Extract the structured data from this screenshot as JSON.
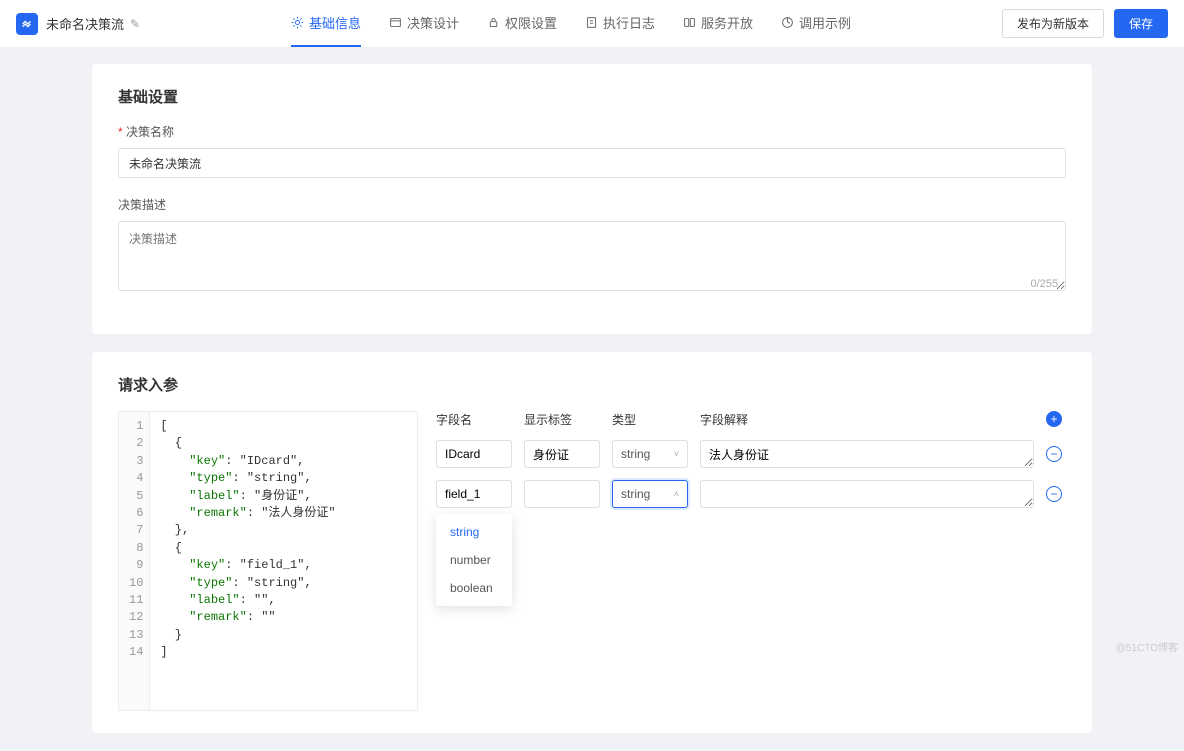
{
  "header": {
    "title": "未命名决策流",
    "tabs": [
      {
        "icon": "setting",
        "label": "基础信息",
        "active": true
      },
      {
        "icon": "design",
        "label": "决策设计"
      },
      {
        "icon": "lock",
        "label": "权限设置"
      },
      {
        "icon": "log",
        "label": "执行日志"
      },
      {
        "icon": "service",
        "label": "服务开放"
      },
      {
        "icon": "example",
        "label": "调用示例"
      }
    ],
    "publish_label": "发布为新版本",
    "save_label": "保存"
  },
  "basic": {
    "heading": "基础设置",
    "name_label": "决策名称",
    "name_value": "未命名决策流",
    "desc_label": "决策描述",
    "desc_placeholder": "决策描述",
    "desc_count": "0/255"
  },
  "params": {
    "heading": "请求入参",
    "code_lines": [
      "[",
      "  {",
      "    \"key\": \"IDcard\",",
      "    \"type\": \"string\",",
      "    \"label\": \"身份证\",",
      "    \"remark\": \"法人身份证\"",
      "  },",
      "  {",
      "    \"key\": \"field_1\",",
      "    \"type\": \"string\",",
      "    \"label\": \"\",",
      "    \"remark\": \"\"",
      "  }",
      "]"
    ],
    "col_field": "字段名",
    "col_label": "显示标签",
    "col_type": "类型",
    "col_remark": "字段解释",
    "rows": [
      {
        "field": "IDcard",
        "label": "身份证",
        "type": "string",
        "remark": "法人身份证",
        "open": false
      },
      {
        "field": "field_1",
        "label": "",
        "type": "string",
        "remark": "",
        "open": true
      }
    ],
    "type_options": [
      "string",
      "number",
      "boolean"
    ]
  },
  "watermark": "@51CTO博客"
}
